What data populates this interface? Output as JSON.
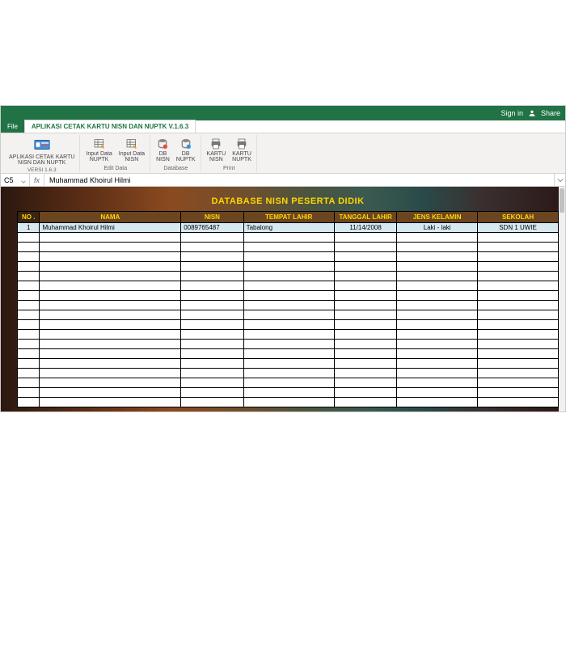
{
  "titlebar": {
    "signin": "Sign in",
    "share": "Share"
  },
  "tabs": {
    "file": "File",
    "ribbon": "APLIKASI CETAK KARTU NISN DAN NUPTK V.1.6.3"
  },
  "ribbon": {
    "g1": {
      "btn": "APLIKASI CETAK KARTU\nNISN DAN NUPTK",
      "label": "VERSI 1.6.3"
    },
    "g2": {
      "b1": "Input Data\nNUPTK",
      "b2": "Input Data\nNISN",
      "label": "Edit Data"
    },
    "g3": {
      "b1": "DB\nNISN",
      "b2": "DB\nNUPTK",
      "label": "Database"
    },
    "g4": {
      "b1": "KARTU\nNISN",
      "b2": "KARTU\nNUPTK",
      "label": "Print"
    }
  },
  "formulaBar": {
    "cell": "C5",
    "fx": "fx",
    "value": "Muhammad Khoirul Hilmi"
  },
  "sheet": {
    "title": "DATABASE NISN PESERTA DIDIK",
    "headers": {
      "no": "NO\n.",
      "nama": "NAMA",
      "nisn": "NISN",
      "tempat": "TEMPAT LAHIR",
      "tanggal": "TANGGAL\nLAHIR",
      "jenis": "JENS KELAMIN",
      "sekolah": "SEKOLAH"
    },
    "rows": [
      {
        "no": "1",
        "nama": "Muhammad Khoirul Hilmi",
        "nisn": "0089765487",
        "tempat": "Tabalong",
        "tanggal": "11/14/2008",
        "jenis": "Laki - laki",
        "sekolah": "SDN 1 UWIE"
      }
    ],
    "emptyRows": 18
  }
}
